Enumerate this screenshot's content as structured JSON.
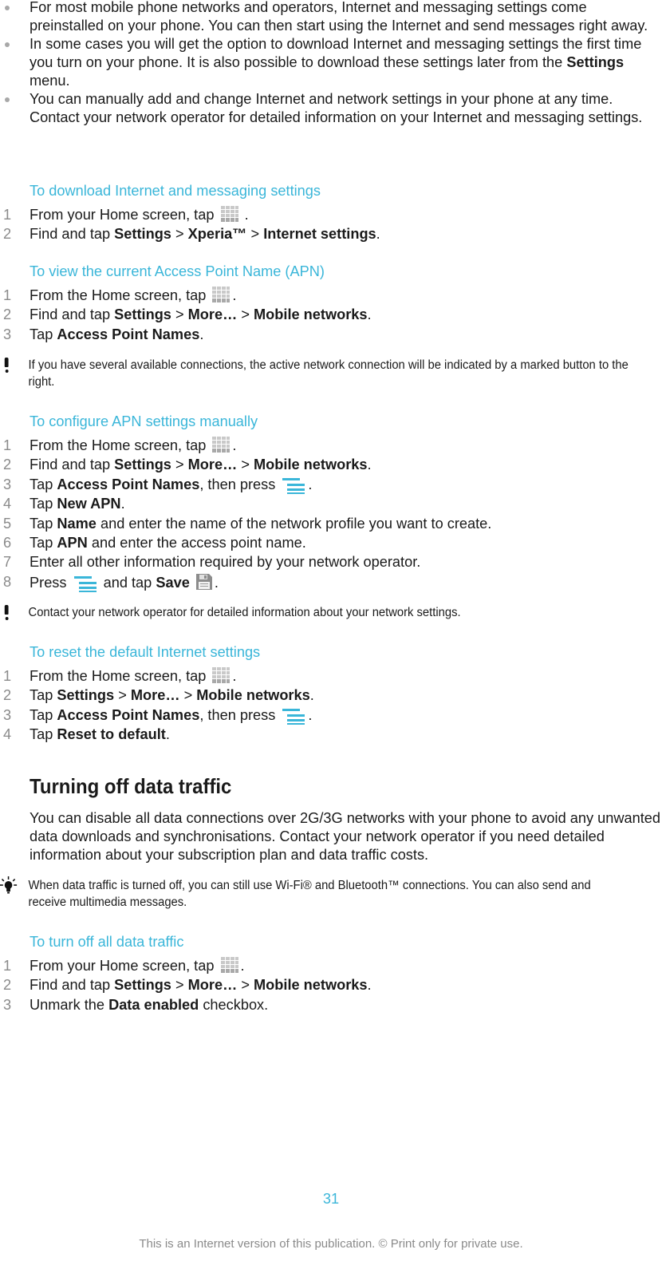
{
  "bullets": [
    {
      "pre": "For most mobile phone networks and operators, Internet and messaging settings come preinstalled on your phone. You can then start using the Internet and send messages right away.",
      "bold": "",
      "post": ""
    },
    {
      "pre": "In some cases you will get the option to download Internet and messaging settings the first time you turn on your phone. It is also possible to download these settings later from the ",
      "bold": "Settings",
      "post": " menu."
    },
    {
      "pre": "You can manually add and change Internet and network settings in your phone at any time. Contact your network operator for detailed information on your Internet and messaging settings.",
      "bold": "",
      "post": ""
    }
  ],
  "download": {
    "title": "To download Internet and messaging settings",
    "steps": [
      {
        "num": "1",
        "pre": "From your Home screen, tap ",
        "post": " ."
      },
      {
        "num": "2",
        "pre": "Find and tap ",
        "b1": "Settings",
        "s1": " > ",
        "b2": "Xperia™",
        "s2": " > ",
        "b3": "Internet settings",
        "post": "."
      }
    ]
  },
  "view_apn": {
    "title": "To view the current Access Point Name (APN)",
    "steps": [
      {
        "num": "1",
        "pre": "From the Home screen, tap ",
        "post": "."
      },
      {
        "num": "2",
        "pre": "Find and tap ",
        "b1": "Settings",
        "s1": " > ",
        "b2": "More…",
        "s2": " > ",
        "b3": "Mobile networks",
        "post": "."
      },
      {
        "num": "3",
        "pre": "Tap ",
        "b1": "Access Point Names",
        "post": "."
      }
    ],
    "note": "If you have several available connections, the active network connection will be indicated by a marked button to the right."
  },
  "configure_apn": {
    "title": "To configure APN settings manually",
    "steps": [
      {
        "num": "1",
        "pre": "From the Home screen, tap ",
        "post": "."
      },
      {
        "num": "2",
        "pre": "Find and tap ",
        "b1": "Settings",
        "s1": " > ",
        "b2": "More…",
        "s2": " > ",
        "b3": "Mobile networks",
        "post": "."
      },
      {
        "num": "3",
        "pre": "Tap ",
        "b1": "Access Point Names",
        "mid": ", then press ",
        "post": "."
      },
      {
        "num": "4",
        "pre": "Tap ",
        "b1": "New APN",
        "post": "."
      },
      {
        "num": "5",
        "pre": "Tap ",
        "b1": "Name",
        "post": " and enter the name of the network profile you want to create."
      },
      {
        "num": "6",
        "pre": "Tap ",
        "b1": "APN",
        "post": " and enter the access point name."
      },
      {
        "num": "7",
        "pre": "Enter all other information required by your network operator."
      },
      {
        "num": "8",
        "pre": "Press ",
        "mid": " and tap ",
        "b1": "Save",
        "post": "."
      }
    ],
    "note": "Contact your network operator for detailed information about your network settings."
  },
  "reset": {
    "title": "To reset the default Internet settings",
    "steps": [
      {
        "num": "1",
        "pre": "From the Home screen, tap ",
        "post": "."
      },
      {
        "num": "2",
        "pre": "Tap ",
        "b1": "Settings",
        "s1": " > ",
        "b2": "More…",
        "s2": " > ",
        "b3": "Mobile networks",
        "post": "."
      },
      {
        "num": "3",
        "pre": "Tap ",
        "b1": "Access Point Names",
        "mid": ", then press ",
        "post": "."
      },
      {
        "num": "4",
        "pre": "Tap ",
        "b1": "Reset to default",
        "post": "."
      }
    ]
  },
  "data_traffic": {
    "heading": "Turning off data traffic",
    "paragraph": "You can disable all data connections over 2G/3G networks with your phone to avoid any unwanted data downloads and synchronisations. Contact your network operator if you need detailed information about your subscription plan and data traffic costs.",
    "tip": "When data traffic is turned off, you can still use Wi-Fi® and Bluetooth™ connections. You can also send and receive multimedia messages."
  },
  "turn_off": {
    "title": "To turn off all data traffic",
    "steps": [
      {
        "num": "1",
        "pre": "From your Home screen, tap ",
        "post": "."
      },
      {
        "num": "2",
        "pre": "Find and tap ",
        "b1": "Settings",
        "s1": " > ",
        "b2": "More…",
        "s2": " > ",
        "b3": "Mobile networks",
        "post": "."
      },
      {
        "num": "3",
        "pre": "Unmark the ",
        "b1": "Data enabled",
        "post": " checkbox."
      }
    ]
  },
  "footer": {
    "page_number": "31",
    "notice": "This is an Internet version of this publication. © Print only for private use."
  },
  "colors": {
    "accent": "#3ab6d9",
    "text": "#1a1a1a",
    "step_number": "#8a8a8a"
  }
}
